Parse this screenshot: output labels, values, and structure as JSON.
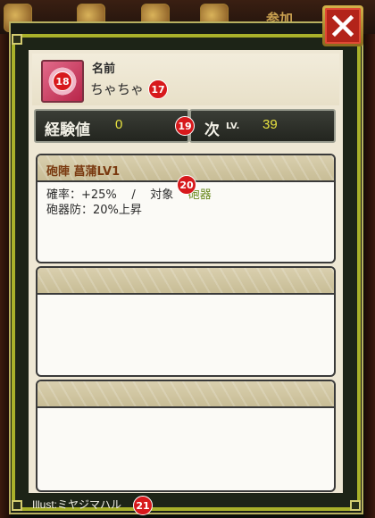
{
  "background": {
    "label": "参加"
  },
  "dialog": {
    "close_icon": "close-x-icon",
    "name_label": "名前",
    "name_value": "ちゃちゃ",
    "exp": {
      "key": "経験値",
      "value": "0",
      "next_key": "次",
      "lv_label": "LV.",
      "next_value": "39"
    },
    "skill": {
      "title": "砲陣 菖蒲LV1",
      "line1_a": "確率：+25%",
      "line1_sep": "/",
      "line1_target": "対象",
      "line1_target_value": "砲器",
      "line2": "砲器防：20%上昇"
    },
    "illust": "Illust:ミヤジマハル"
  },
  "markers": {
    "m17": "17",
    "m18": "18",
    "m19": "19",
    "m20": "20",
    "m21": "21"
  },
  "colors": {
    "accent_green": "#6a8a20",
    "exp_value": "#e8e240",
    "marker": "#d7191c",
    "close_red": "#b3241a"
  }
}
